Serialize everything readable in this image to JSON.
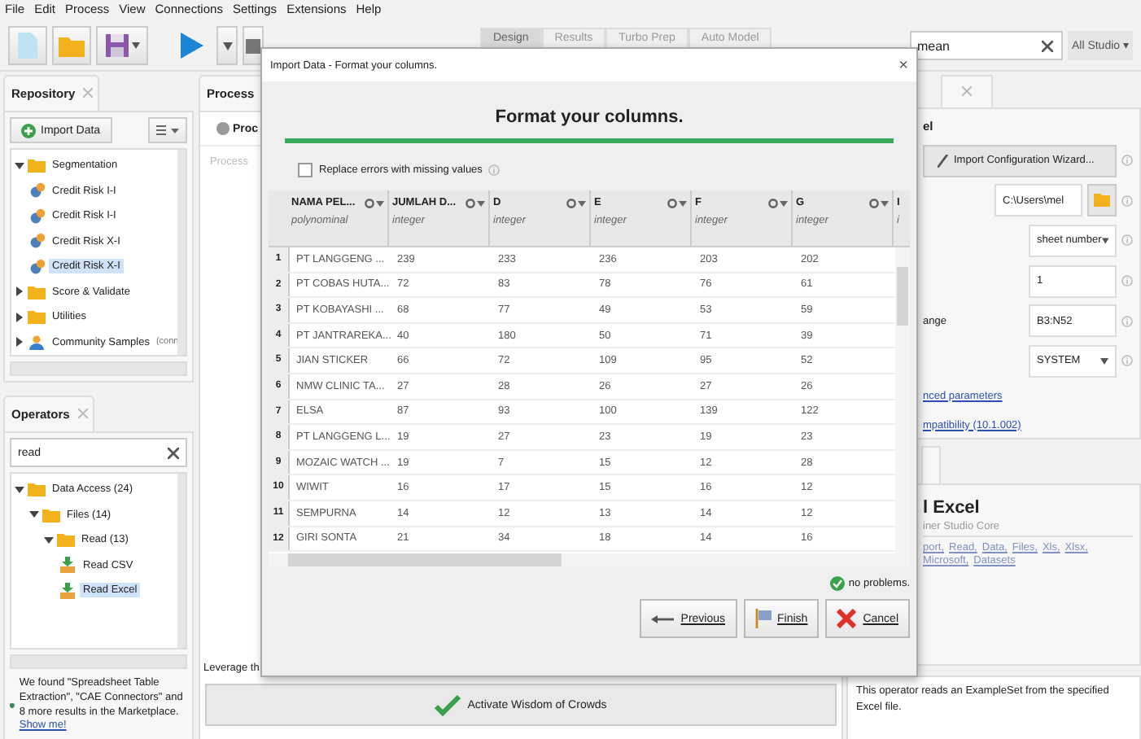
{
  "menu": [
    "File",
    "Edit",
    "Process",
    "View",
    "Connections",
    "Settings",
    "Extensions",
    "Help"
  ],
  "view_tabs": [
    {
      "label": "Design",
      "selected": true
    },
    {
      "label": "Results",
      "selected": false
    },
    {
      "label": "Turbo Prep",
      "selected": false
    },
    {
      "label": "Auto Model",
      "selected": false
    }
  ],
  "global_search": {
    "value": "mean",
    "scope": "All Studio ▾"
  },
  "repository": {
    "title": "Repository",
    "import_button": "Import Data",
    "tree": [
      {
        "label": "Segmentation",
        "kind": "folder",
        "expanded": true,
        "selected": false,
        "children": [
          {
            "label": "Credit Risk I-I",
            "kind": "process",
            "selected": false
          },
          {
            "label": "Credit Risk I-I",
            "kind": "process",
            "selected": false
          },
          {
            "label": "Credit Risk X-I",
            "kind": "process",
            "selected": false
          },
          {
            "label": "Credit Risk X-I",
            "kind": "process",
            "selected": true
          }
        ]
      },
      {
        "label": "Score & Validate",
        "kind": "folder",
        "expanded": false,
        "selected": false
      },
      {
        "label": "Utilities",
        "kind": "folder",
        "expanded": false,
        "selected": false
      },
      {
        "label": "Community Samples",
        "kind": "samples",
        "expanded": false,
        "selected": false,
        "note": "(conn"
      }
    ]
  },
  "operators": {
    "title": "Operators",
    "search": "read",
    "tree": [
      {
        "label": "Data Access (24)",
        "kind": "folder",
        "expanded": true,
        "selected": false,
        "children": [
          {
            "label": "Files (14)",
            "kind": "folder",
            "expanded": true,
            "selected": false,
            "children": [
              {
                "label": "Read (13)",
                "kind": "folder",
                "expanded": true,
                "selected": false,
                "children": [
                  {
                    "label": "Read CSV",
                    "kind": "operator",
                    "selected": false
                  },
                  {
                    "label": "Read Excel",
                    "kind": "operator",
                    "selected": true
                  }
                ]
              }
            ]
          }
        ]
      }
    ]
  },
  "marketplace": {
    "text": "We found \"Spreadsheet Table Extraction\", \"CAE Connectors\" and 8 more results in the Marketplace.",
    "link": "Show me!"
  },
  "process": {
    "tab": "Process",
    "button": "Proc",
    "breadcrumb": "Process",
    "hint": "Leverage th",
    "wisdom_button": "Activate Wisdom of Crowds"
  },
  "parameters": {
    "title": "el",
    "wizard_button": "Import Configuration Wizard...",
    "fields": [
      {
        "kind": "file",
        "value": "C:\\Users\\mel"
      },
      {
        "kind": "select",
        "value": "sheet number"
      },
      {
        "kind": "text",
        "value": "1"
      },
      {
        "kind": "text",
        "label": "ange",
        "value": "B3:N52"
      },
      {
        "kind": "select",
        "value": "SYSTEM"
      }
    ],
    "links": [
      "nced parameters",
      "mpatibility (10.1.002)"
    ]
  },
  "help": {
    "title": "l Excel",
    "subtitle": "iner Studio Core",
    "tags": [
      "port,",
      "Read,",
      "Data,",
      "Files,",
      "Xls,",
      "Xlsx,",
      "Microsoft,",
      "Datasets"
    ],
    "description": "This operator reads an ExampleSet from the specified Excel file."
  },
  "dialog": {
    "title": "Import Data - Format your columns.",
    "close": "×",
    "heading": "Format your columns.",
    "progress": {
      "level": 1
    },
    "replace_errors": {
      "label": "Replace errors with missing values",
      "checked": false
    },
    "columns": [
      {
        "name": "NAMA PEL...",
        "type": "polynominal"
      },
      {
        "name": "JUMLAH D...",
        "type": "integer"
      },
      {
        "name": "D",
        "type": "integer"
      },
      {
        "name": "E",
        "type": "integer"
      },
      {
        "name": "F",
        "type": "integer"
      },
      {
        "name": "G",
        "type": "integer"
      },
      {
        "name": "I",
        "type": "i"
      }
    ],
    "rows": [
      {
        "index": "1",
        "cells": [
          "PT LANGGENG ...",
          "239",
          "233",
          "236",
          "203",
          "202"
        ]
      },
      {
        "index": "2",
        "cells": [
          "PT COBAS HUTA...",
          "72",
          "83",
          "78",
          "76",
          "61"
        ]
      },
      {
        "index": "3",
        "cells": [
          "PT KOBAYASHI ...",
          "68",
          "77",
          "49",
          "53",
          "59"
        ]
      },
      {
        "index": "4",
        "cells": [
          "PT JANTRAREKA...",
          "40",
          "180",
          "50",
          "71",
          "39"
        ]
      },
      {
        "index": "5",
        "cells": [
          "JIAN STICKER",
          "66",
          "72",
          "109",
          "95",
          "52"
        ]
      },
      {
        "index": "6",
        "cells": [
          "NMW CLINIC TA...",
          "27",
          "28",
          "26",
          "27",
          "26"
        ]
      },
      {
        "index": "7",
        "cells": [
          "ELSA",
          "87",
          "93",
          "100",
          "139",
          "122"
        ]
      },
      {
        "index": "8",
        "cells": [
          "PT LANGGENG L...",
          "19",
          "27",
          "23",
          "19",
          "23"
        ]
      },
      {
        "index": "9",
        "cells": [
          "MOZAIC WATCH ...",
          "19",
          "7",
          "15",
          "12",
          "28"
        ]
      },
      {
        "index": "10",
        "cells": [
          "WIWIT",
          "16",
          "17",
          "15",
          "16",
          "12"
        ]
      },
      {
        "index": "11",
        "cells": [
          "SEMPURNA",
          "14",
          "12",
          "13",
          "14",
          "12"
        ]
      },
      {
        "index": "12",
        "cells": [
          "GIRI SONTA",
          "21",
          "34",
          "18",
          "14",
          "16"
        ]
      }
    ],
    "status": "no problems.",
    "buttons": [
      {
        "label": "Previous",
        "kind": "previous"
      },
      {
        "label": "Finish",
        "kind": "finish"
      },
      {
        "label": "Cancel",
        "kind": "cancel"
      }
    ]
  }
}
